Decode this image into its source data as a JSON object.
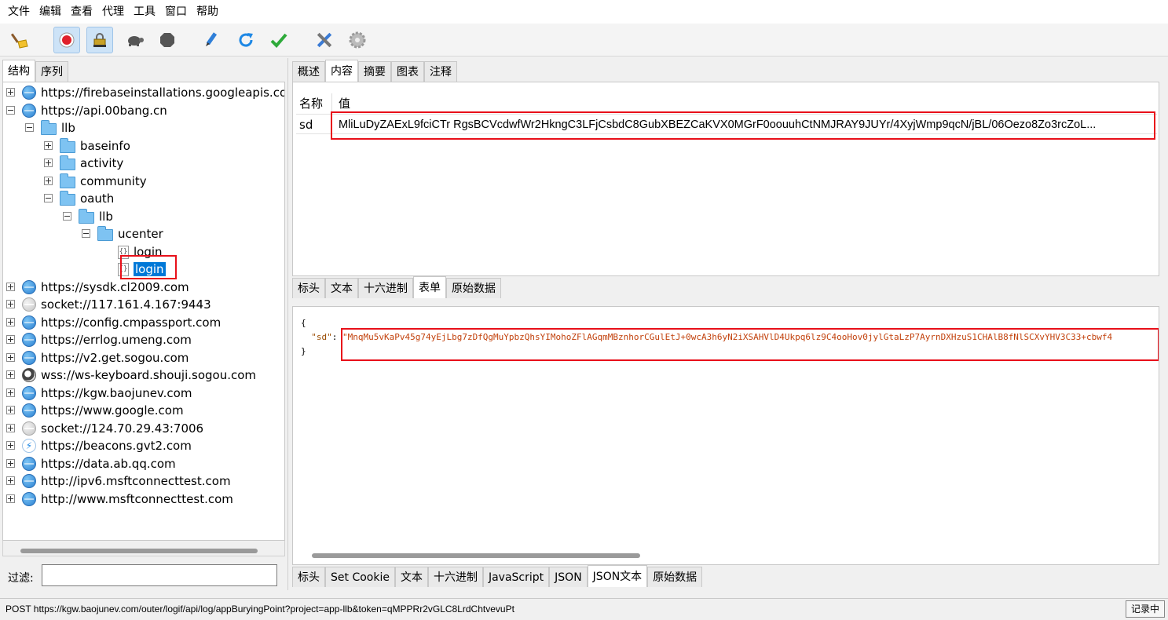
{
  "menu": [
    "文件",
    "编辑",
    "查看",
    "代理",
    "工具",
    "窗口",
    "帮助"
  ],
  "toolbar": {
    "icons": [
      "broom-icon",
      "record-icon",
      "ssl-lock-icon",
      "turtle-icon",
      "stop-icon",
      "pen-icon",
      "refresh-icon",
      "check-icon",
      "tools-icon",
      "gear-icon"
    ]
  },
  "left_tabs": [
    "结构",
    "序列"
  ],
  "tree": [
    {
      "label": "https://firebaseinstallations.googleapis.com",
      "icon": "globe"
    },
    {
      "label": "https://api.00bang.cn",
      "icon": "globe"
    },
    {
      "label": "llb",
      "icon": "folder"
    },
    {
      "label": "baseinfo",
      "icon": "folder"
    },
    {
      "label": "activity",
      "icon": "folder"
    },
    {
      "label": "community",
      "icon": "folder"
    },
    {
      "label": "oauth",
      "icon": "folder"
    },
    {
      "label": "llb",
      "icon": "folder"
    },
    {
      "label": "ucenter",
      "icon": "folder"
    },
    {
      "label": "login",
      "icon": "file"
    },
    {
      "label": "login",
      "icon": "file"
    },
    {
      "label": "https://sysdk.cl2009.com",
      "icon": "globe"
    },
    {
      "label": "socket://117.161.4.167:9443",
      "icon": "globe-gray"
    },
    {
      "label": "https://config.cmpassport.com",
      "icon": "globe"
    },
    {
      "label": "https://errlog.umeng.com",
      "icon": "globe"
    },
    {
      "label": "https://v2.get.sogou.com",
      "icon": "globe"
    },
    {
      "label": "wss://ws-keyboard.shouji.sogou.com",
      "icon": "globe-dark"
    },
    {
      "label": "https://kgw.baojunev.com",
      "icon": "globe"
    },
    {
      "label": "https://www.google.com",
      "icon": "globe"
    },
    {
      "label": "socket://124.70.29.43:7006",
      "icon": "globe-gray"
    },
    {
      "label": "https://beacons.gvt2.com",
      "icon": "globe-bolt"
    },
    {
      "label": "https://data.ab.qq.com",
      "icon": "globe"
    },
    {
      "label": "http://ipv6.msftconnecttest.com",
      "icon": "globe"
    },
    {
      "label": "http://www.msftconnecttest.com",
      "icon": "globe"
    }
  ],
  "filter": {
    "label": "过滤:",
    "value": ""
  },
  "right_tabs": [
    "概述",
    "内容",
    "摘要",
    "图表",
    "注释"
  ],
  "request_table": {
    "headers": [
      "名称",
      "值"
    ],
    "rows": [
      {
        "name": "sd",
        "value": "MliLuDyZAExL9fciCTr RgsBCVcdwfWr2HkngC3LFjCsbdC8GubXBEZCaKVX0MGrF0oouuhCtNMJRAY9JUYr/4XyjWmp9qcN/jBL/06Oezo8Zo3rcZoL..."
      }
    ]
  },
  "request_tabs": [
    "标头",
    "文本",
    "十六进制",
    "表单",
    "原始数据"
  ],
  "response_json": {
    "open": "{",
    "key": "\"sd\"",
    "colon": ":",
    "value": "\"MnqMu5vKaPv45g74yEjLbg7zDfQgMuYpbzQhsYIMohoZFlAGqmMBznhorCGulEtJ+0wcA3h6yN2iXSAHVlD4Ukpq6lz9C4ooHov0jylGtaLzP7AyrnDXHzuS1CHAlB8fNlSCXvYHV3C33+cbwf4",
    "close": "}"
  },
  "response_tabs": [
    "标头",
    "Set Cookie",
    "文本",
    "十六进制",
    "JavaScript",
    "JSON",
    "JSON文本",
    "原始数据"
  ],
  "status": {
    "text": "POST https://kgw.baojunev.com/outer/logif/api/log/appBuryingPoint?project=app-llb&token=qMPPRr2vGLC8LrdChtvevuPt",
    "recording": "记录中"
  }
}
